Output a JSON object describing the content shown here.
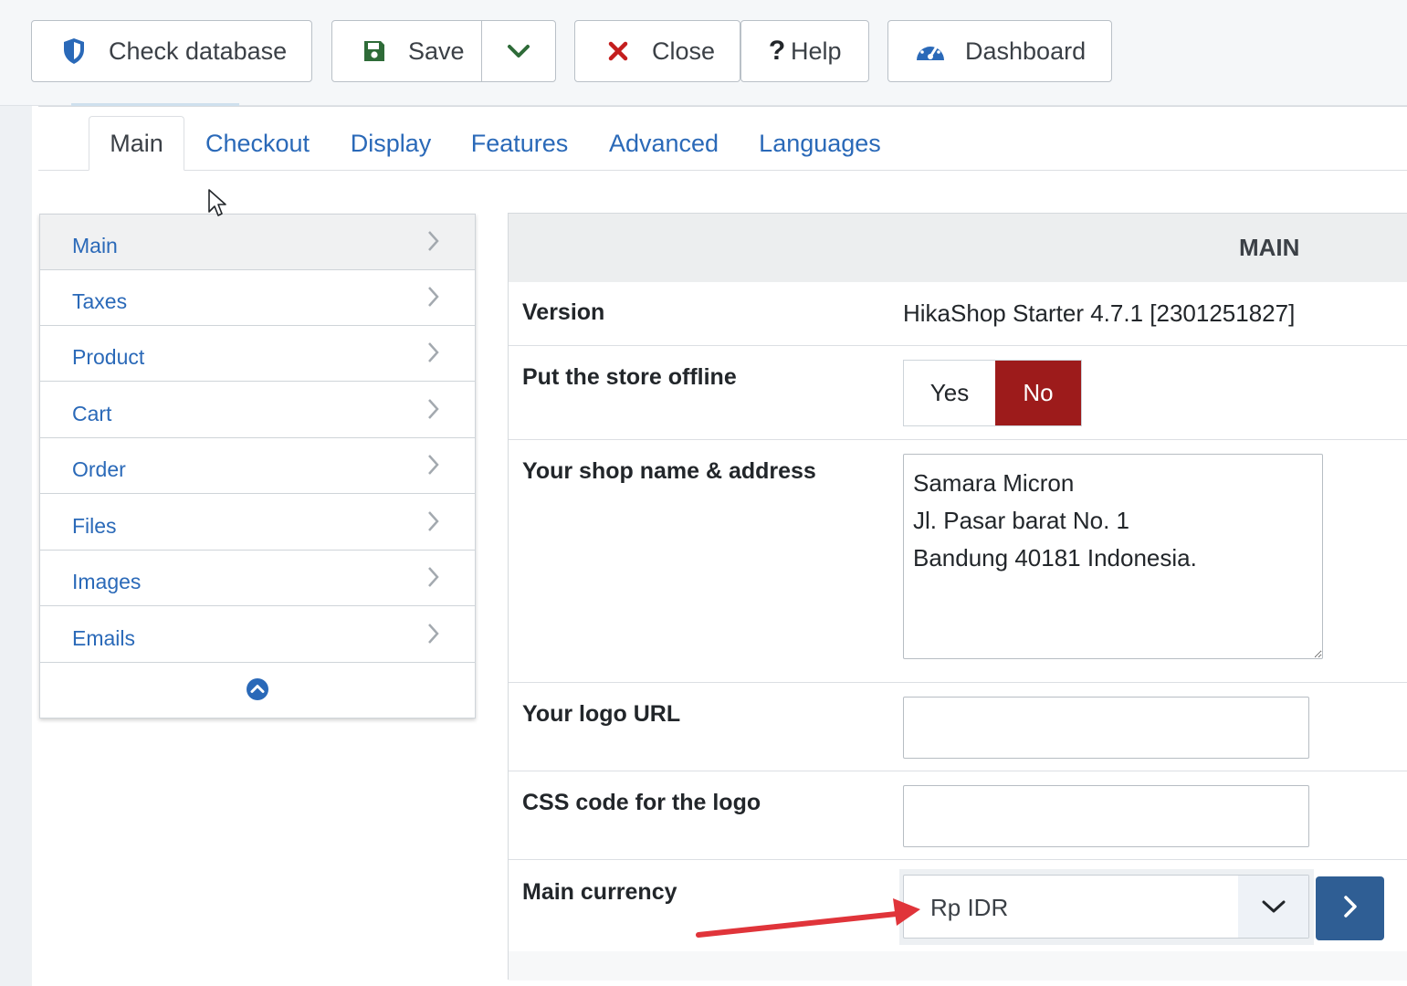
{
  "toolbar": {
    "check_database": "Check database",
    "save": "Save",
    "close": "Close",
    "help": "Help",
    "dashboard": "Dashboard",
    "colors": {
      "shield": "#2a69b8",
      "save": "#2e6b38",
      "close": "#c41e1e",
      "dashboard": "#2a69b8"
    }
  },
  "tabs": [
    {
      "label": "Main",
      "active": true
    },
    {
      "label": "Checkout"
    },
    {
      "label": "Display"
    },
    {
      "label": "Features"
    },
    {
      "label": "Advanced"
    },
    {
      "label": "Languages"
    }
  ],
  "sidebar": {
    "items": [
      {
        "label": "Main",
        "active": true
      },
      {
        "label": "Taxes"
      },
      {
        "label": "Product"
      },
      {
        "label": "Cart"
      },
      {
        "label": "Order"
      },
      {
        "label": "Files"
      },
      {
        "label": "Images"
      },
      {
        "label": "Emails"
      }
    ],
    "collapse_icon": "chevron-up-circle-icon"
  },
  "panel": {
    "title": "MAIN",
    "version": {
      "label": "Version",
      "value": "HikaShop Starter 4.7.1 [2301251827]"
    },
    "offline": {
      "label": "Put the store offline",
      "yes": "Yes",
      "no": "No",
      "selected": "No",
      "selected_color": "#9d1b1b"
    },
    "address": {
      "label": "Your shop name & address",
      "value": "Samara Micron\nJl. Pasar barat No. 1\nBandung 40181 Indonesia."
    },
    "logo_url": {
      "label": "Your logo URL",
      "value": ""
    },
    "logo_css": {
      "label": "CSS code for the logo",
      "value": ""
    },
    "currency": {
      "label": "Main currency",
      "value": "Rp IDR",
      "button_color": "#2f5e94"
    }
  },
  "annotation": {
    "arrow_color": "#e0343a"
  }
}
